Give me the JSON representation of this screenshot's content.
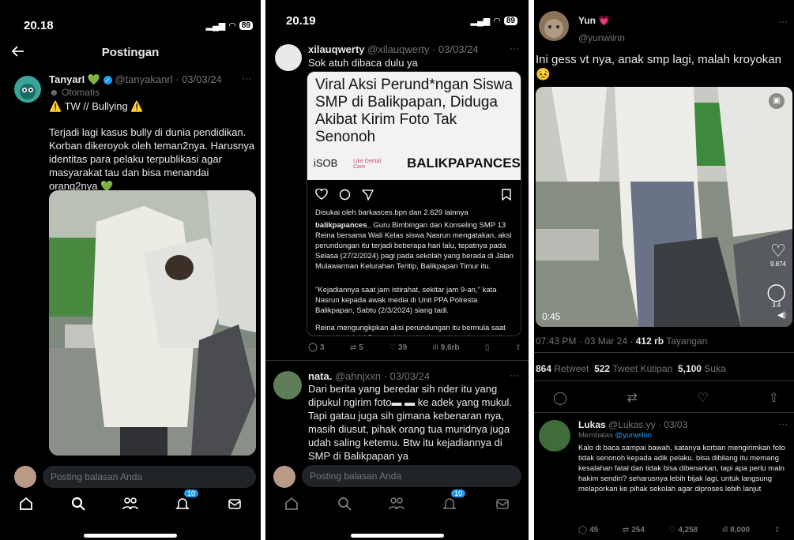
{
  "colors": {
    "accent": "#1d9bf0",
    "muted": "#71767b",
    "heart": "#f91880",
    "green": "#19cf86"
  },
  "p1": {
    "status_time": "20.18",
    "battery": "89",
    "header_title": "Postingan",
    "tweet": {
      "name": "TanyarI",
      "name_emoji": "💚",
      "handle_date": "@tanyakanrl · 03/03/24",
      "automated": "Otomatis",
      "tw_line": "⚠️ TW // Bullying ⚠️",
      "body": "Terjadi lagi kasus bully di dunia pendidikan. Korban dikeroyok oleh teman2nya. Harusnya identitas para pelaku terpublikasi agar masyarakat tau dan bisa menandai orang2nya 💚"
    },
    "reply_placeholder": "Posting balasan Anda",
    "notif_badge": "10",
    "more": "···"
  },
  "p2": {
    "status_time": "20.19",
    "battery": "89",
    "tweet1": {
      "name": "xilauqwerty",
      "handle_date": "@xilauqwerty · 03/03/24",
      "text": "Sok atuh dibaca dulu ya"
    },
    "ig": {
      "headline": "Viral Aksi Perund*ngan Siswa SMP di Balikpapan, Diduga Akibat Kirim Foto Tak Senonoh",
      "brand1": "iSOB",
      "brand2": "Like Dental Care",
      "brand3": "BALIKPAPANCES",
      "liked_by": "Disukai oleh barkasces.bpn dan 2.629 lainnya",
      "caption_user": "balikpapances_",
      "caption": "Guru Bimbingan dan Konseling SMP 13 Reina bersama Wali Kelas siswa Nasrun mengatakan, aksi perundungan itu terjadi beberapa hari lalu, tepatnya pada Selasa (27/2/2024) pagi pada sekolah yang berada di Jalan Mulawarman Kelurahan Teritip, Balikpapan Timur itu.",
      "para2": "\"Kejadiannya saat jam istirahat, sekitar jam 9-an,\" kata Nasrun kepada awak media di Unit PPA Polresta Balikpapan, Sabtu (2/3/2024) siang tadi.",
      "para3": "Reina mengungkpkan aksi perundungan itu bermula saat siswa berinisial R mengirim sebuah gambar tak senonoh"
    },
    "actions": {
      "replies": "3",
      "retweets": "5",
      "likes": "39",
      "views": "9,6rb"
    },
    "tweet2": {
      "name": "nata.",
      "handle_date": "@ahnjxxn · 03/03/24",
      "text": "Dari berita yang beredar sih nder itu yang dipukul ngirim foto▬ ▬ ke adek yang mukul. Tapi gatau juga sih gimana kebenaran nya, masih diusut, pihak orang tua muridnya juga udah saling ketemu. Btw itu kejadiannya di SMP di Balikpapan ya"
    },
    "reply_placeholder": "Posting balasan Anda",
    "notif_badge": "10",
    "more": "···"
  },
  "p3": {
    "name": "Yun",
    "name_emoji": "💗",
    "handle": "@yunwiinn",
    "text": "Ini gess vt nya, anak smp lagi, malah kroyokan 😣",
    "video_time": "0:45",
    "video_likes": "9.874",
    "video_comments": "3.4",
    "meta_time": "07:43 PM · 03 Mar 24 · ",
    "meta_views": "412 rb",
    "meta_views_label": " Tayangan",
    "retweets": "864",
    "retweets_label": " Retweet",
    "quotes": "522",
    "quotes_label": " Tweet Kutipan",
    "likes": "5,100",
    "likes_label": " Suka",
    "reply": {
      "name": "Lukas",
      "handle_date": "@Lukas.yy · 03/03",
      "replying_prefix": "Membalas ",
      "replying_to": "@yunwiinn",
      "text": "Kalo di baca sampai bawah, katanya korban mengirimkan foto tidak senonoh kepada adik pelaku. bisa dibilang itu memang kesalahan fatal dan tidak bisa dibenarkan, tapi apa perlu main hakim sendiri? seharusnya lebih bijak lagi, untuk langsung melaporkan ke pihak sekolah agar diproses lebih lanjut",
      "replies": "45",
      "retweets": "254",
      "likes": "4,258",
      "views": "8,000"
    },
    "more": "···"
  }
}
